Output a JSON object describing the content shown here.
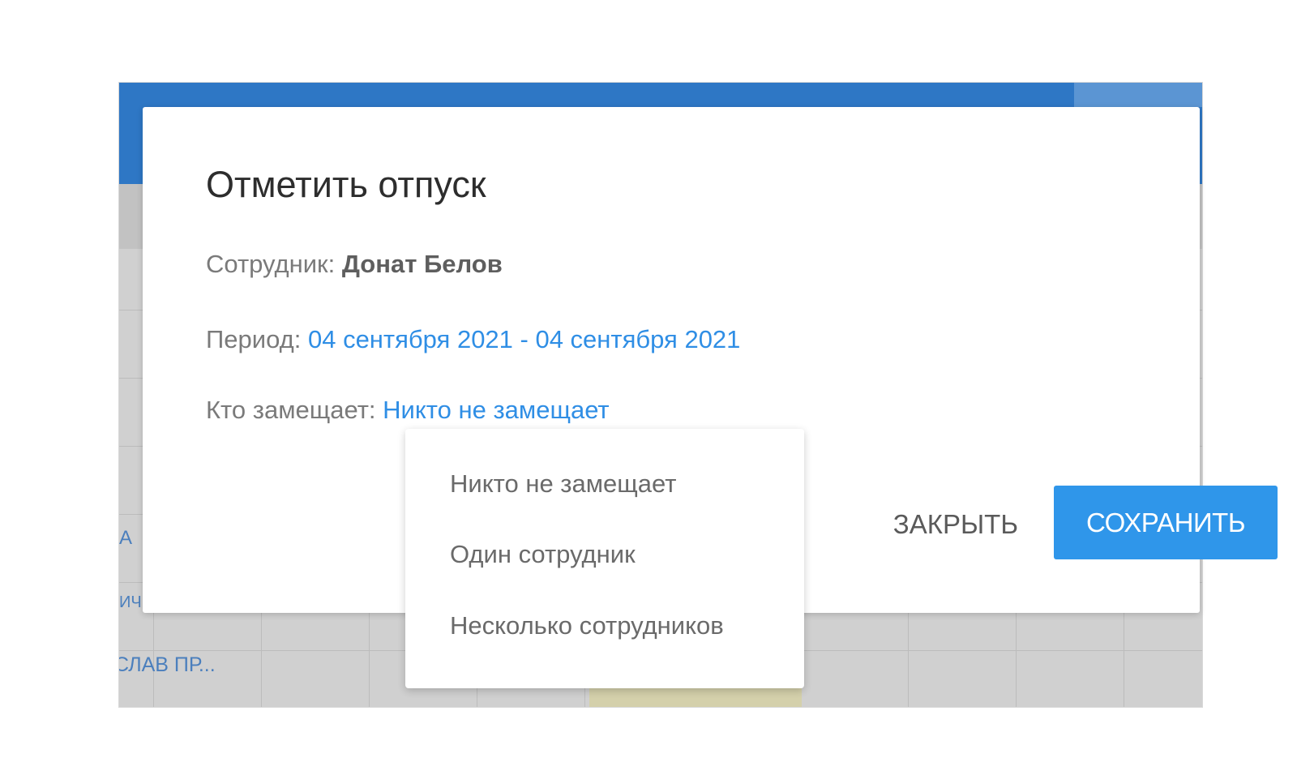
{
  "background_app": {
    "row_labels": [
      "А",
      "ИЧ",
      "СЛАВ ПР..."
    ]
  },
  "dialog": {
    "title": "Отметить отпуск",
    "employee_label": "Сотрудник:",
    "employee_name": "Донат Белов",
    "period_label": "Период:",
    "period_value": "04 сентября 2021 - 04 сентября 2021",
    "substitute_label": "Кто замещает:",
    "substitute_value": "Никто не замещает",
    "close_button": "ЗАКРЫТЬ",
    "save_button": "СОХРАНИТЬ"
  },
  "dropdown": {
    "options": [
      "Никто не замещает",
      "Один сотрудник",
      "Несколько сотрудников"
    ]
  },
  "colors": {
    "header": "#2e77c5",
    "accent": "#2f96ea",
    "link": "#2f8ee5"
  }
}
